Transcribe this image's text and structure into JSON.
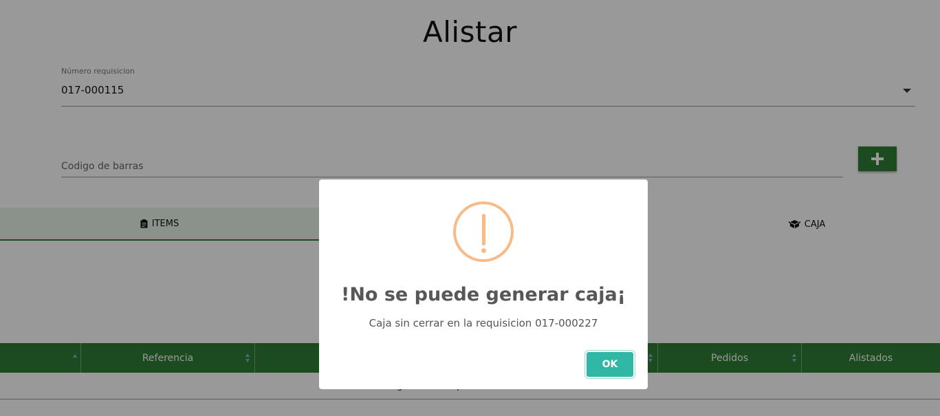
{
  "page": {
    "title": "Alistar"
  },
  "requisicion": {
    "label": "Número requisicion",
    "value": "017-000115"
  },
  "barcode": {
    "placeholder": "Codigo de barras"
  },
  "tabs": [
    {
      "label": "ITEMS",
      "icon": "clipboard-icon"
    },
    {
      "label": "CAJA",
      "icon": "box-icon"
    }
  ],
  "table": {
    "columns": [
      "",
      "Referencia",
      "",
      "Pedidos",
      "Alistados"
    ],
    "sort_icons": [
      "sort-asc-icon",
      "sort-icon",
      "sort-icon",
      "sort-icon",
      ""
    ],
    "empty_text": "ningún dato disponible en esta tabla"
  },
  "modal": {
    "icon": "warning-icon",
    "title": "!No se puede generar caja¡",
    "text": "Caja sin cerrar en la requisicion 017-000227",
    "ok_label": "OK"
  },
  "colors": {
    "primary": "#2e7d32",
    "ok_button": "#30b7a6",
    "warning": "#f8bb86"
  }
}
